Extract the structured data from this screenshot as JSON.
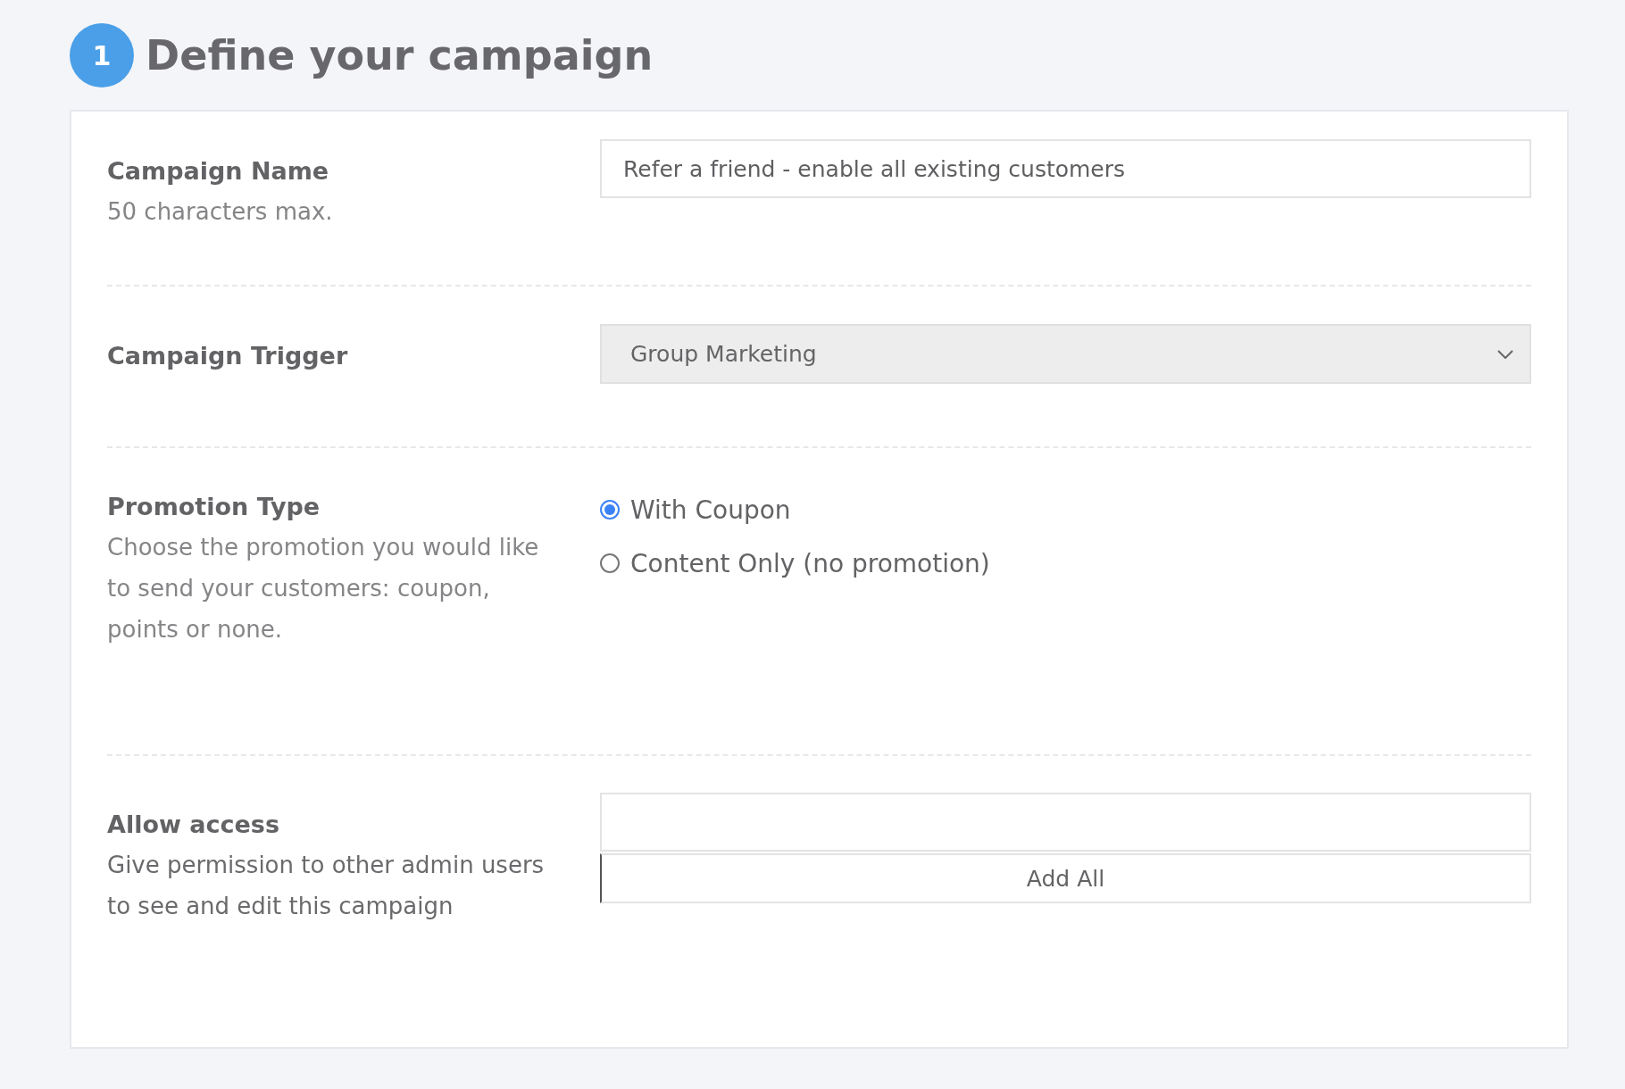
{
  "heading": {
    "step": "1",
    "title": "Define your campaign"
  },
  "fields": [
    {
      "kind": "text",
      "label": "Campaign Name",
      "hint": "50 characters max.",
      "value": "Refer a friend - enable all existing customers"
    },
    {
      "kind": "select",
      "label": "Campaign Trigger",
      "value": "Group Marketing"
    },
    {
      "kind": "radio",
      "label": "Promotion Type",
      "hint": "Choose the promotion you would like to send your customers: coupon, points or none.",
      "options": [
        {
          "label": "With Coupon",
          "selected": true
        },
        {
          "label": "Content Only (no promotion)",
          "selected": false
        }
      ]
    },
    {
      "kind": "access",
      "label": "Allow access",
      "hint": "Give permission to other admin users to see and edit this campaign",
      "button": "Add All"
    }
  ]
}
